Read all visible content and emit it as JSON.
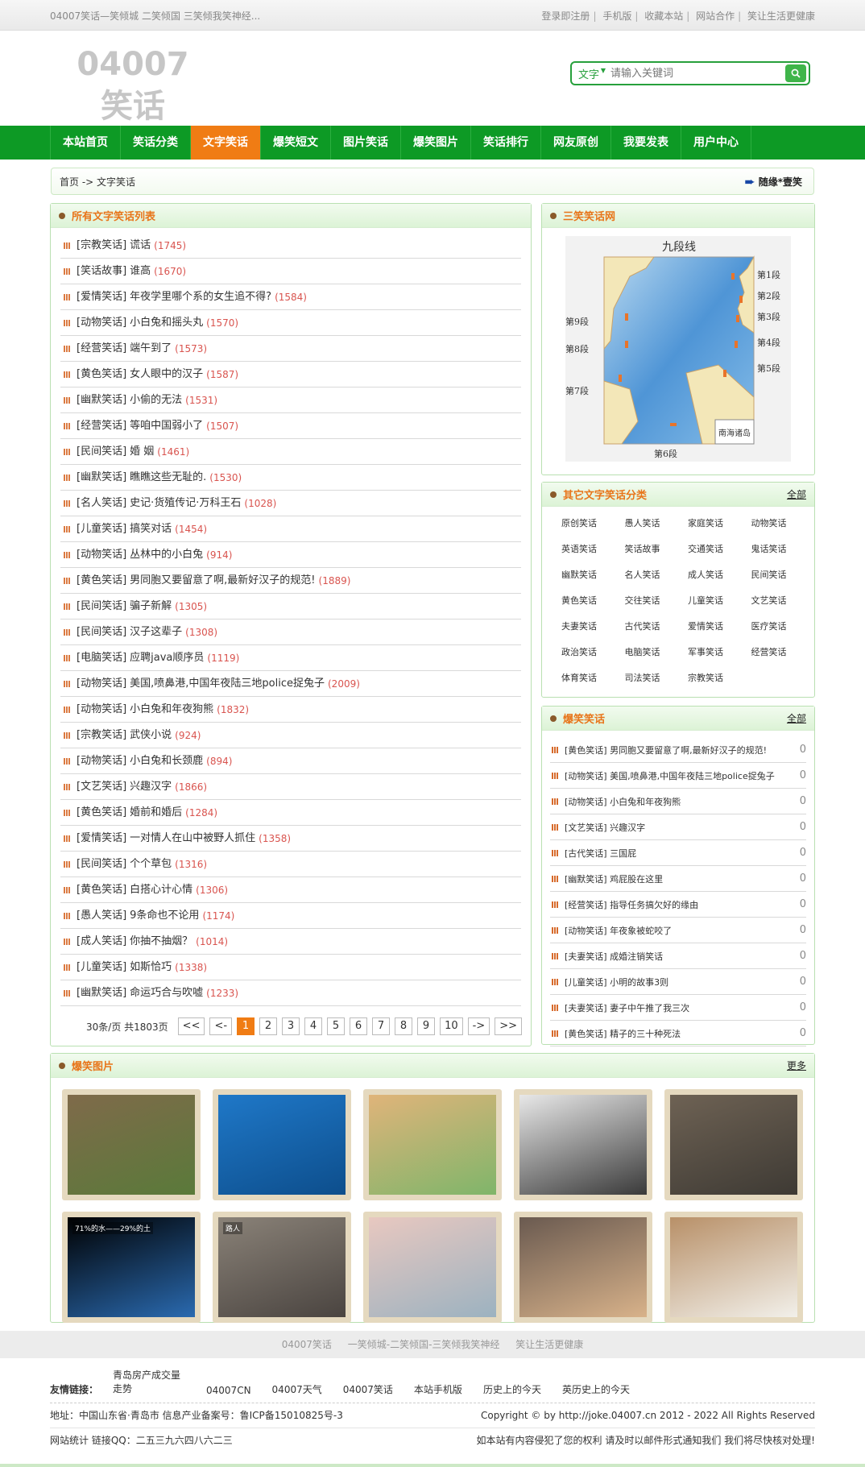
{
  "topbar": {
    "title": "04007笑话—笑倾城 二笑倾国 三笑倾我笑神经...",
    "links": [
      "登录即注册",
      "手机版",
      "收藏本站",
      "网站合作",
      "笑让生活更健康"
    ]
  },
  "header": {
    "logo": "04007笑话",
    "search_type": "文字",
    "search_placeholder": "请输入关键词"
  },
  "nav": [
    "本站首页",
    "笑话分类",
    "文字笑话",
    "爆笑短文",
    "图片笑话",
    "爆笑图片",
    "笑话排行",
    "网友原创",
    "我要发表",
    "用户中心"
  ],
  "breadcrumb": {
    "home": "首页",
    "sep": " -> ",
    "current": "文字笑话",
    "random": "随缘*壹笑"
  },
  "left": {
    "title": "所有文字笑话列表",
    "rows": [
      {
        "cat": "[宗教笑话]",
        "title": "谎话",
        "count": "(1745)"
      },
      {
        "cat": "[笑话故事]",
        "title": "谁高",
        "count": "(1670)"
      },
      {
        "cat": "[爱情笑话]",
        "title": "年夜学里哪个系的女生追不得?",
        "count": "(1584)"
      },
      {
        "cat": "[动物笑话]",
        "title": "小白兔和摇头丸",
        "count": "(1570)"
      },
      {
        "cat": "[经营笑话]",
        "title": "端午到了",
        "count": "(1573)"
      },
      {
        "cat": "[黄色笑话]",
        "title": "女人眼中的汉子",
        "count": "(1587)"
      },
      {
        "cat": "[幽默笑话]",
        "title": "小偷的无法",
        "count": "(1531)"
      },
      {
        "cat": "[经营笑话]",
        "title": "等咱中国弱小了",
        "count": "(1507)"
      },
      {
        "cat": "[民间笑话]",
        "title": "婚 姻",
        "count": "(1461)"
      },
      {
        "cat": "[幽默笑话]",
        "title": "瞧瞧这些无耻的.",
        "count": "(1530)"
      },
      {
        "cat": "[名人笑话]",
        "title": "史记·货殖传记·万科王石",
        "count": "(1028)"
      },
      {
        "cat": "[儿童笑话]",
        "title": "搞笑对话",
        "count": "(1454)"
      },
      {
        "cat": "[动物笑话]",
        "title": "丛林中的小白兔",
        "count": "(914)"
      },
      {
        "cat": "[黄色笑话]",
        "title": "男同胞又要留意了啊,最新好汉子的规范!",
        "count": "(1889)"
      },
      {
        "cat": "[民间笑话]",
        "title": "骗子新解",
        "count": "(1305)"
      },
      {
        "cat": "[民间笑话]",
        "title": "汉子这辈子",
        "count": "(1308)"
      },
      {
        "cat": "[电脑笑话]",
        "title": "应聘java顺序员",
        "count": "(1119)"
      },
      {
        "cat": "[动物笑话]",
        "title": "美国,喷鼻港,中国年夜陆三地police捉兔子",
        "count": "(2009)"
      },
      {
        "cat": "[动物笑话]",
        "title": "小白兔和年夜狗熊",
        "count": "(1832)"
      },
      {
        "cat": "[宗教笑话]",
        "title": "武侠小说",
        "count": "(924)"
      },
      {
        "cat": "[动物笑话]",
        "title": "小白兔和长颈鹿",
        "count": "(894)"
      },
      {
        "cat": "[文艺笑话]",
        "title": "兴趣汉字",
        "count": "(1866)"
      },
      {
        "cat": "[黄色笑话]",
        "title": "婚前和婚后",
        "count": "(1284)"
      },
      {
        "cat": "[爱情笑话]",
        "title": "一对情人在山中被野人抓住",
        "count": "(1358)"
      },
      {
        "cat": "[民间笑话]",
        "title": "个个草包",
        "count": "(1316)"
      },
      {
        "cat": "[黄色笑话]",
        "title": "白搭心计心情",
        "count": "(1306)"
      },
      {
        "cat": "[愚人笑话]",
        "title": "9条命也不论用",
        "count": "(1174)"
      },
      {
        "cat": "[成人笑话]",
        "title": "你抽不抽烟？",
        "count": "(1014)"
      },
      {
        "cat": "[儿童笑话]",
        "title": "如斯恰巧",
        "count": "(1338)"
      },
      {
        "cat": "[幽默笑话]",
        "title": "命运巧合与吹嘘",
        "count": "(1233)"
      }
    ],
    "pager": {
      "info": "30条/页 共1803页",
      "buttons": [
        "<<",
        "<-",
        "1",
        "2",
        "3",
        "4",
        "5",
        "6",
        "7",
        "8",
        "9",
        "10",
        "->",
        ">>"
      ],
      "current": "1"
    }
  },
  "right1": {
    "title": "三笑笑话网",
    "map": {
      "title": "九段线",
      "labels_right": [
        "第1段",
        "第2段",
        "第3段",
        "第4段",
        "第5段"
      ],
      "labels_left": [
        "第9段",
        "第8段",
        "第7段"
      ],
      "bottom": "第6段",
      "inset": "南海诸岛"
    }
  },
  "right2": {
    "title": "其它文字笑话分类",
    "more": "全部",
    "cats": [
      "原创笑话",
      "愚人笑话",
      "家庭笑话",
      "动物笑话",
      "英语笑话",
      "笑话故事",
      "交通笑话",
      "鬼话笑话",
      "幽默笑话",
      "名人笑话",
      "成人笑话",
      "民间笑话",
      "黄色笑话",
      "交往笑话",
      "儿童笑话",
      "文艺笑话",
      "夫妻笑话",
      "古代笑话",
      "爱情笑话",
      "医疗笑话",
      "政治笑话",
      "电脑笑话",
      "军事笑话",
      "经营笑话",
      "体育笑话",
      "司法笑话",
      "宗教笑话"
    ]
  },
  "right3": {
    "title": "爆笑笑话",
    "more": "全部",
    "rows": [
      {
        "text": "[黄色笑话] 男同胞又要留意了啊,最新好汉子的规范!",
        "n": "0"
      },
      {
        "text": "[动物笑话] 美国,喷鼻港,中国年夜陆三地police捉兔子",
        "n": "0"
      },
      {
        "text": "[动物笑话] 小白兔和年夜狗熊",
        "n": "0"
      },
      {
        "text": "[文艺笑话] 兴趣汉字",
        "n": "0"
      },
      {
        "text": "[古代笑话] 三国屁",
        "n": "0"
      },
      {
        "text": "[幽默笑话] 鸡屁股在这里",
        "n": "0"
      },
      {
        "text": "[经营笑话] 指导任务搞欠好的缘由",
        "n": "0"
      },
      {
        "text": "[动物笑话] 年夜象被蛇咬了",
        "n": "0"
      },
      {
        "text": "[夫妻笑话] 成婚注销笑话",
        "n": "0"
      },
      {
        "text": "[儿童笑话] 小明的故事3则",
        "n": "0"
      },
      {
        "text": "[夫妻笑话] 妻子中午推了我三次",
        "n": "0"
      },
      {
        "text": "[黄色笑话] 精子的三十种死法",
        "n": "0"
      }
    ]
  },
  "pictures": {
    "title": "爆笑图片",
    "more": "更多",
    "items": [
      {
        "name": "elephant-photo",
        "colors": [
          "#7f6a4a",
          "#5a7a3a"
        ]
      },
      {
        "name": "turtle-photo",
        "colors": [
          "#1f78c8",
          "#0d4e8c"
        ]
      },
      {
        "name": "dog-photo",
        "colors": [
          "#e0b47a",
          "#7fb56a"
        ]
      },
      {
        "name": "costume-photo",
        "colors": [
          "#e8e8e8",
          "#3a3a3a"
        ]
      },
      {
        "name": "sealion-photo",
        "colors": [
          "#6e6254",
          "#3e3a34"
        ]
      },
      {
        "name": "earth-photo",
        "colors": [
          "#000000",
          "#2a6ab0"
        ],
        "caption": "71%的水——29%的土"
      },
      {
        "name": "cats-photo",
        "colors": [
          "#8a8278",
          "#4a4440"
        ],
        "caption": "路人"
      },
      {
        "name": "legs-photo",
        "colors": [
          "#e8c8c0",
          "#9cb2c0"
        ]
      },
      {
        "name": "crowd-photo",
        "colors": [
          "#6a5a50",
          "#d8b28a"
        ]
      },
      {
        "name": "cup-photo",
        "colors": [
          "#b89068",
          "#f2f0ea"
        ]
      }
    ]
  },
  "footer": {
    "links": [
      "04007笑话",
      "一笑倾城-二笑倾国-三笑倾我笑神经",
      "笑让生活更健康"
    ],
    "friends_label": "友情链接：",
    "friends": [
      "青岛房产成交量走势",
      "04007CN",
      "04007天气",
      "04007笑话",
      "本站手机版",
      "历史上的今天",
      "英历史上的今天"
    ],
    "address": "地址：中国山东省·青岛市 信息产业备案号：鲁ICP备15010825号-3",
    "copyright": "Copyright © by http://joke.04007.cn 2012 - 2022 All Rights Reserved",
    "stats": "网站统计 链接QQ：二五三九六四八六二三",
    "notice": "如本站有内容侵犯了您的权利 请及时以邮件形式通知我们 我们将尽快核对处理!"
  }
}
